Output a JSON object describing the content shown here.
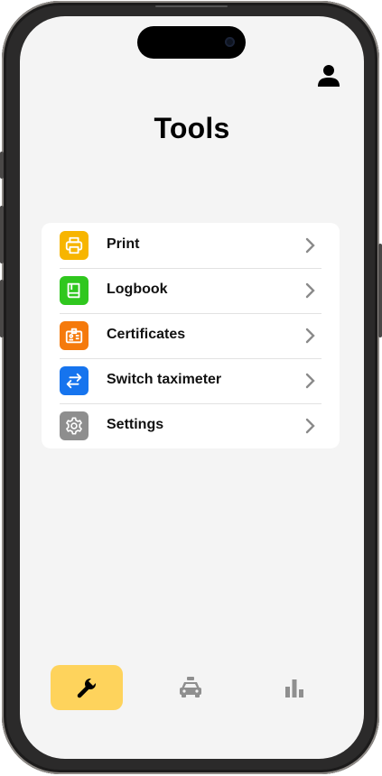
{
  "header": {
    "title": "Tools"
  },
  "menu": {
    "items": [
      {
        "label": "Print",
        "icon": "printer-icon",
        "color": "#f7b500"
      },
      {
        "label": "Logbook",
        "icon": "book-icon",
        "color": "#2fc71e"
      },
      {
        "label": "Certificates",
        "icon": "id-card-icon",
        "color": "#f57a0c"
      },
      {
        "label": "Switch taximeter",
        "icon": "swap-arrows-icon",
        "color": "#1674ee"
      },
      {
        "label": "Settings",
        "icon": "gear-icon",
        "color": "#8e8e8e"
      }
    ]
  },
  "tabbar": {
    "items": [
      {
        "icon": "wrench-icon",
        "active": true
      },
      {
        "icon": "taxi-icon",
        "active": false
      },
      {
        "icon": "bar-chart-icon",
        "active": false
      }
    ],
    "active_color": "#fed35c"
  }
}
